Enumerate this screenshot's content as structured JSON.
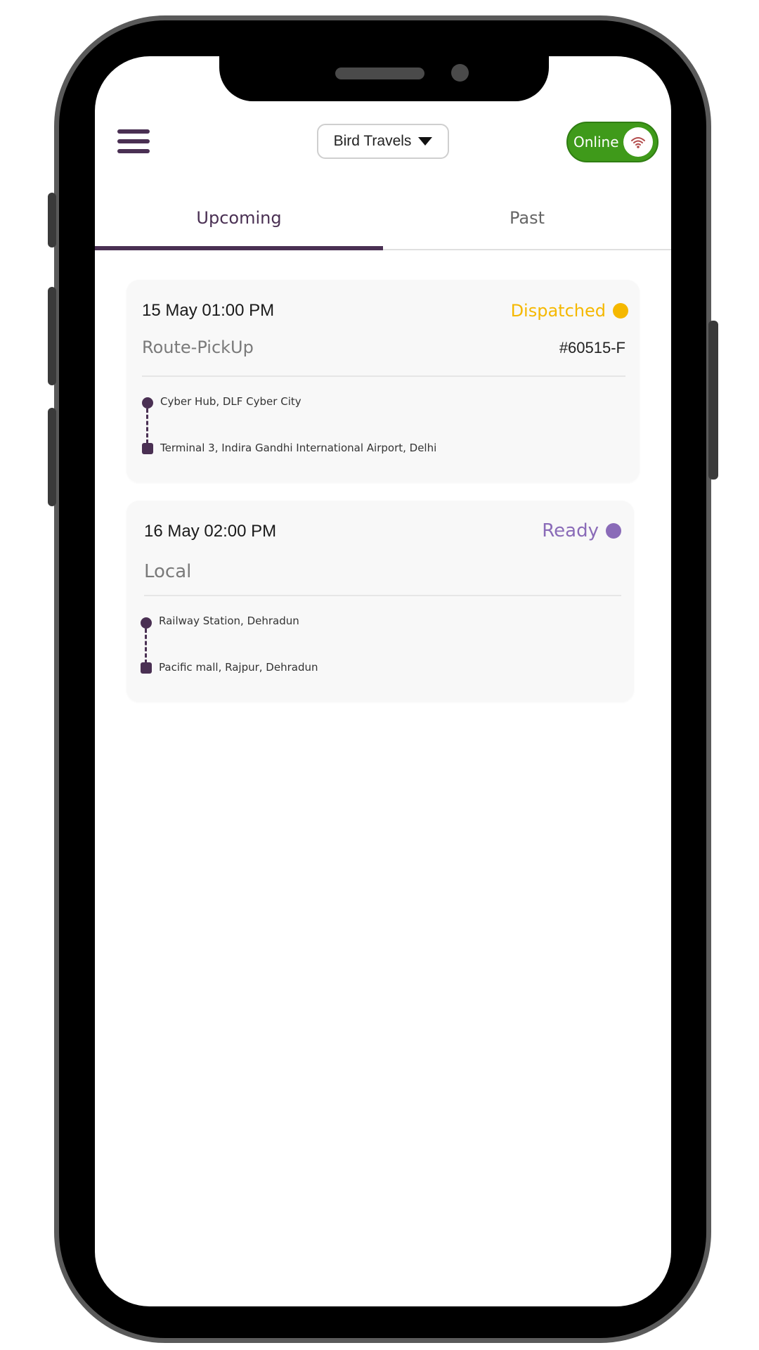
{
  "header": {
    "company": "Bird Travels",
    "status_label": "Online"
  },
  "tabs": {
    "upcoming": "Upcoming",
    "past": "Past"
  },
  "trips": [
    {
      "datetime": "15 May 01:00 PM",
      "status": "Dispatched",
      "status_color": "#f5b800",
      "type": "Route-PickUp",
      "id": "#60515-F",
      "pickup": "Cyber Hub, DLF Cyber City",
      "drop": "Terminal 3, Indira Gandhi International Airport, Delhi"
    },
    {
      "datetime": "16 May 02:00 PM",
      "status": "Ready",
      "status_color": "#8a6bb8",
      "type": "Local",
      "pickup": "Railway Station,  Dehradun",
      "drop": "Pacific mall, Rajpur, Dehradun"
    }
  ],
  "colors": {
    "brand": "#4a3053",
    "online": "#3f9a1a"
  }
}
